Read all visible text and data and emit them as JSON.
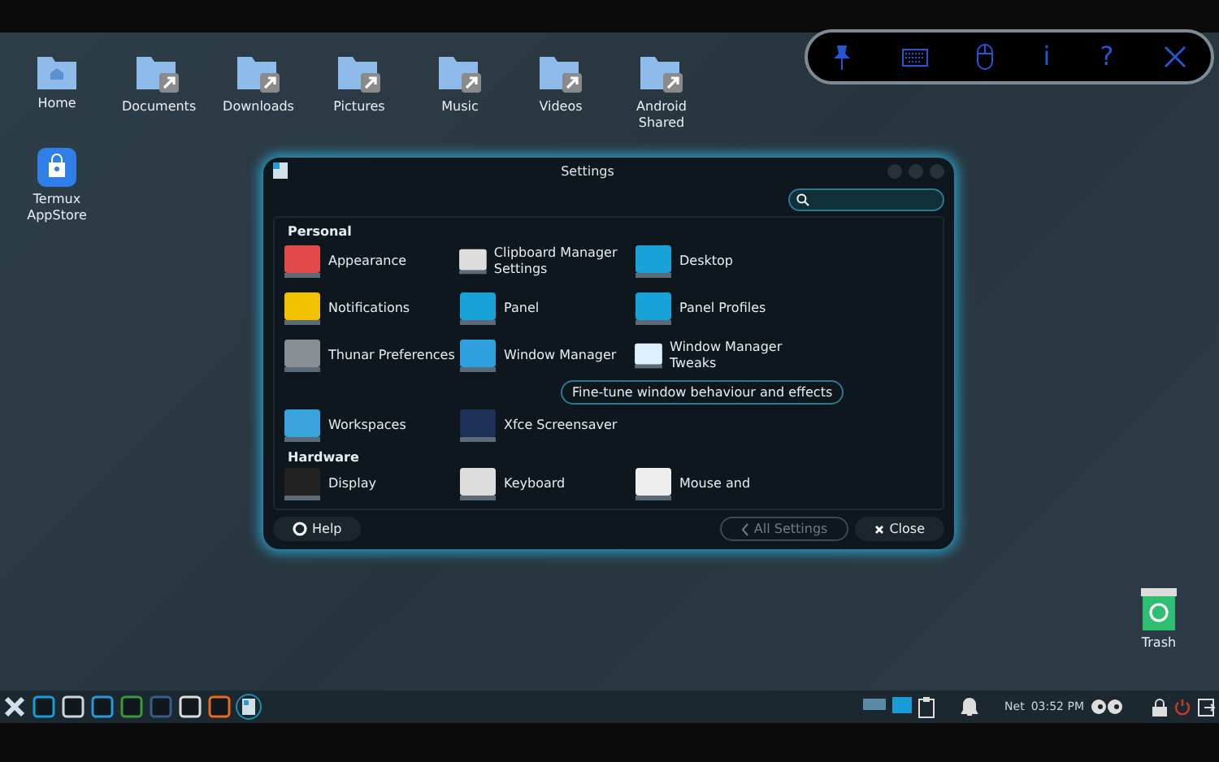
{
  "toolbar": {
    "info_label": "i",
    "help_label": "?"
  },
  "desktop_icons": [
    {
      "label": "Home",
      "kind": "home"
    },
    {
      "label": "Documents",
      "kind": "link"
    },
    {
      "label": "Downloads",
      "kind": "link"
    },
    {
      "label": "Pictures",
      "kind": "link"
    },
    {
      "label": "Music",
      "kind": "link"
    },
    {
      "label": "Videos",
      "kind": "link"
    },
    {
      "label": "Android Shared",
      "kind": "link"
    },
    {
      "label": "Termux AppStore",
      "kind": "store"
    }
  ],
  "trash": {
    "label": "Trash"
  },
  "settings_window": {
    "title": "Settings",
    "sections": [
      {
        "title": "Personal",
        "items": [
          {
            "label": "Appearance"
          },
          {
            "label": "Clipboard Manager Settings"
          },
          {
            "label": "Desktop"
          },
          {
            "label": "Notifications"
          },
          {
            "label": "Panel"
          },
          {
            "label": "Panel Profiles"
          },
          {
            "label": "Thunar Preferences"
          },
          {
            "label": "Window Manager"
          },
          {
            "label": "Window Manager Tweaks"
          },
          {
            "label": "Workspaces"
          },
          {
            "label": "Xfce Screensaver"
          }
        ]
      },
      {
        "title": "Hardware",
        "items": [
          {
            "label": "Display"
          },
          {
            "label": "Keyboard"
          },
          {
            "label": "Mouse and"
          }
        ]
      }
    ],
    "tooltip": "Fine-tune window behaviour and effects",
    "help_button": "Help",
    "all_settings_button": {
      "label": "All Settings",
      "disabled": true
    },
    "close_button": "Close"
  },
  "taskbar": {
    "net_label": "Net",
    "clock": "03:52 PM"
  }
}
